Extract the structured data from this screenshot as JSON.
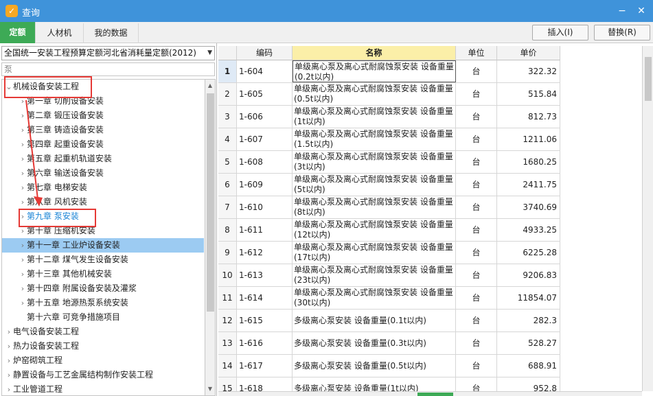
{
  "window": {
    "title": "查询"
  },
  "tabs": [
    {
      "label": "定额",
      "active": true
    },
    {
      "label": "人材机",
      "active": false
    },
    {
      "label": "我的数据",
      "active": false
    }
  ],
  "toolbar": {
    "insert_label": "插入(I)",
    "replace_label": "替换(R)"
  },
  "sidebar": {
    "library": "全国统一安装工程预算定额河北省消耗量定额(2012)",
    "search_value": "泵",
    "tree": [
      {
        "label": "机械设备安装工程",
        "level": 0,
        "expanded": true
      },
      {
        "label": "第一章  切削设备安装",
        "level": 1
      },
      {
        "label": "第二章  锻压设备安装",
        "level": 1
      },
      {
        "label": "第三章  铸造设备安装",
        "level": 1
      },
      {
        "label": "第四章  起重设备安装",
        "level": 1
      },
      {
        "label": "第五章  起重机轨道安装",
        "level": 1
      },
      {
        "label": "第六章  输送设备安装",
        "level": 1
      },
      {
        "label": "第七章  电梯安装",
        "level": 1
      },
      {
        "label": "第八章  风机安装",
        "level": 1
      },
      {
        "label": "第九章  泵安装",
        "level": 1,
        "highlight": true
      },
      {
        "label": "第十章  压缩机安装",
        "level": 1
      },
      {
        "label": "第十一章  工业炉设备安装",
        "level": 1,
        "selected": true
      },
      {
        "label": "第十二章  煤气发生设备安装",
        "level": 1
      },
      {
        "label": "第十三章  其他机械安装",
        "level": 1
      },
      {
        "label": "第十四章  附属设备安装及灌浆",
        "level": 1
      },
      {
        "label": "第十五章  地源热泵系统安装",
        "level": 1
      },
      {
        "label": "第十六章  可竞争措施项目",
        "level": 1,
        "leaf": true
      },
      {
        "label": "电气设备安装工程",
        "level": 0
      },
      {
        "label": "热力设备安装工程",
        "level": 0
      },
      {
        "label": "炉窑砌筑工程",
        "level": 0
      },
      {
        "label": "静置设备与工艺金属结构制作安装工程",
        "level": 0
      },
      {
        "label": "工业管道工程",
        "level": 0
      }
    ]
  },
  "grid": {
    "headers": {
      "num": "",
      "code": "编码",
      "name": "名称",
      "unit": "单位",
      "price": "单价"
    },
    "rows": [
      {
        "num": "1",
        "code": "1-604",
        "name1": "单级离心泵及离心式耐腐蚀泵安装 设备重量",
        "name2": "(0.2t以内)",
        "unit": "台",
        "price": "322.32"
      },
      {
        "num": "2",
        "code": "1-605",
        "name1": "单级离心泵及离心式耐腐蚀泵安装 设备重量",
        "name2": "(0.5t以内)",
        "unit": "台",
        "price": "515.84"
      },
      {
        "num": "3",
        "code": "1-606",
        "name1": "单级离心泵及离心式耐腐蚀泵安装 设备重量",
        "name2": "(1t以内)",
        "unit": "台",
        "price": "812.73"
      },
      {
        "num": "4",
        "code": "1-607",
        "name1": "单级离心泵及离心式耐腐蚀泵安装 设备重量",
        "name2": "(1.5t以内)",
        "unit": "台",
        "price": "1211.06"
      },
      {
        "num": "5",
        "code": "1-608",
        "name1": "单级离心泵及离心式耐腐蚀泵安装 设备重量",
        "name2": "(3t以内)",
        "unit": "台",
        "price": "1680.25"
      },
      {
        "num": "6",
        "code": "1-609",
        "name1": "单级离心泵及离心式耐腐蚀泵安装 设备重量",
        "name2": "(5t以内)",
        "unit": "台",
        "price": "2411.75"
      },
      {
        "num": "7",
        "code": "1-610",
        "name1": "单级离心泵及离心式耐腐蚀泵安装 设备重量",
        "name2": "(8t以内)",
        "unit": "台",
        "price": "3740.69"
      },
      {
        "num": "8",
        "code": "1-611",
        "name1": "单级离心泵及离心式耐腐蚀泵安装 设备重量",
        "name2": "(12t以内)",
        "unit": "台",
        "price": "4933.25"
      },
      {
        "num": "9",
        "code": "1-612",
        "name1": "单级离心泵及离心式耐腐蚀泵安装 设备重量",
        "name2": "(17t以内)",
        "unit": "台",
        "price": "6225.28"
      },
      {
        "num": "10",
        "code": "1-613",
        "name1": "单级离心泵及离心式耐腐蚀泵安装 设备重量",
        "name2": "(23t以内)",
        "unit": "台",
        "price": "9206.83"
      },
      {
        "num": "11",
        "code": "1-614",
        "name1": "单级离心泵及离心式耐腐蚀泵安装 设备重量",
        "name2": "(30t以内)",
        "unit": "台",
        "price": "11854.07"
      },
      {
        "num": "12",
        "code": "1-615",
        "name1": "多级离心泵安装 设备重量(0.1t以内)",
        "name2": "",
        "unit": "台",
        "price": "282.3"
      },
      {
        "num": "13",
        "code": "1-616",
        "name1": "多级离心泵安装 设备重量(0.3t以内)",
        "name2": "",
        "unit": "台",
        "price": "528.27"
      },
      {
        "num": "14",
        "code": "1-617",
        "name1": "多级离心泵安装 设备重量(0.5t以内)",
        "name2": "",
        "unit": "台",
        "price": "688.91"
      },
      {
        "num": "15",
        "code": "1-618",
        "name1": "多级离心泵安装 设备重量(1t以内)",
        "name2": "",
        "unit": "台",
        "price": "952.8"
      }
    ]
  }
}
